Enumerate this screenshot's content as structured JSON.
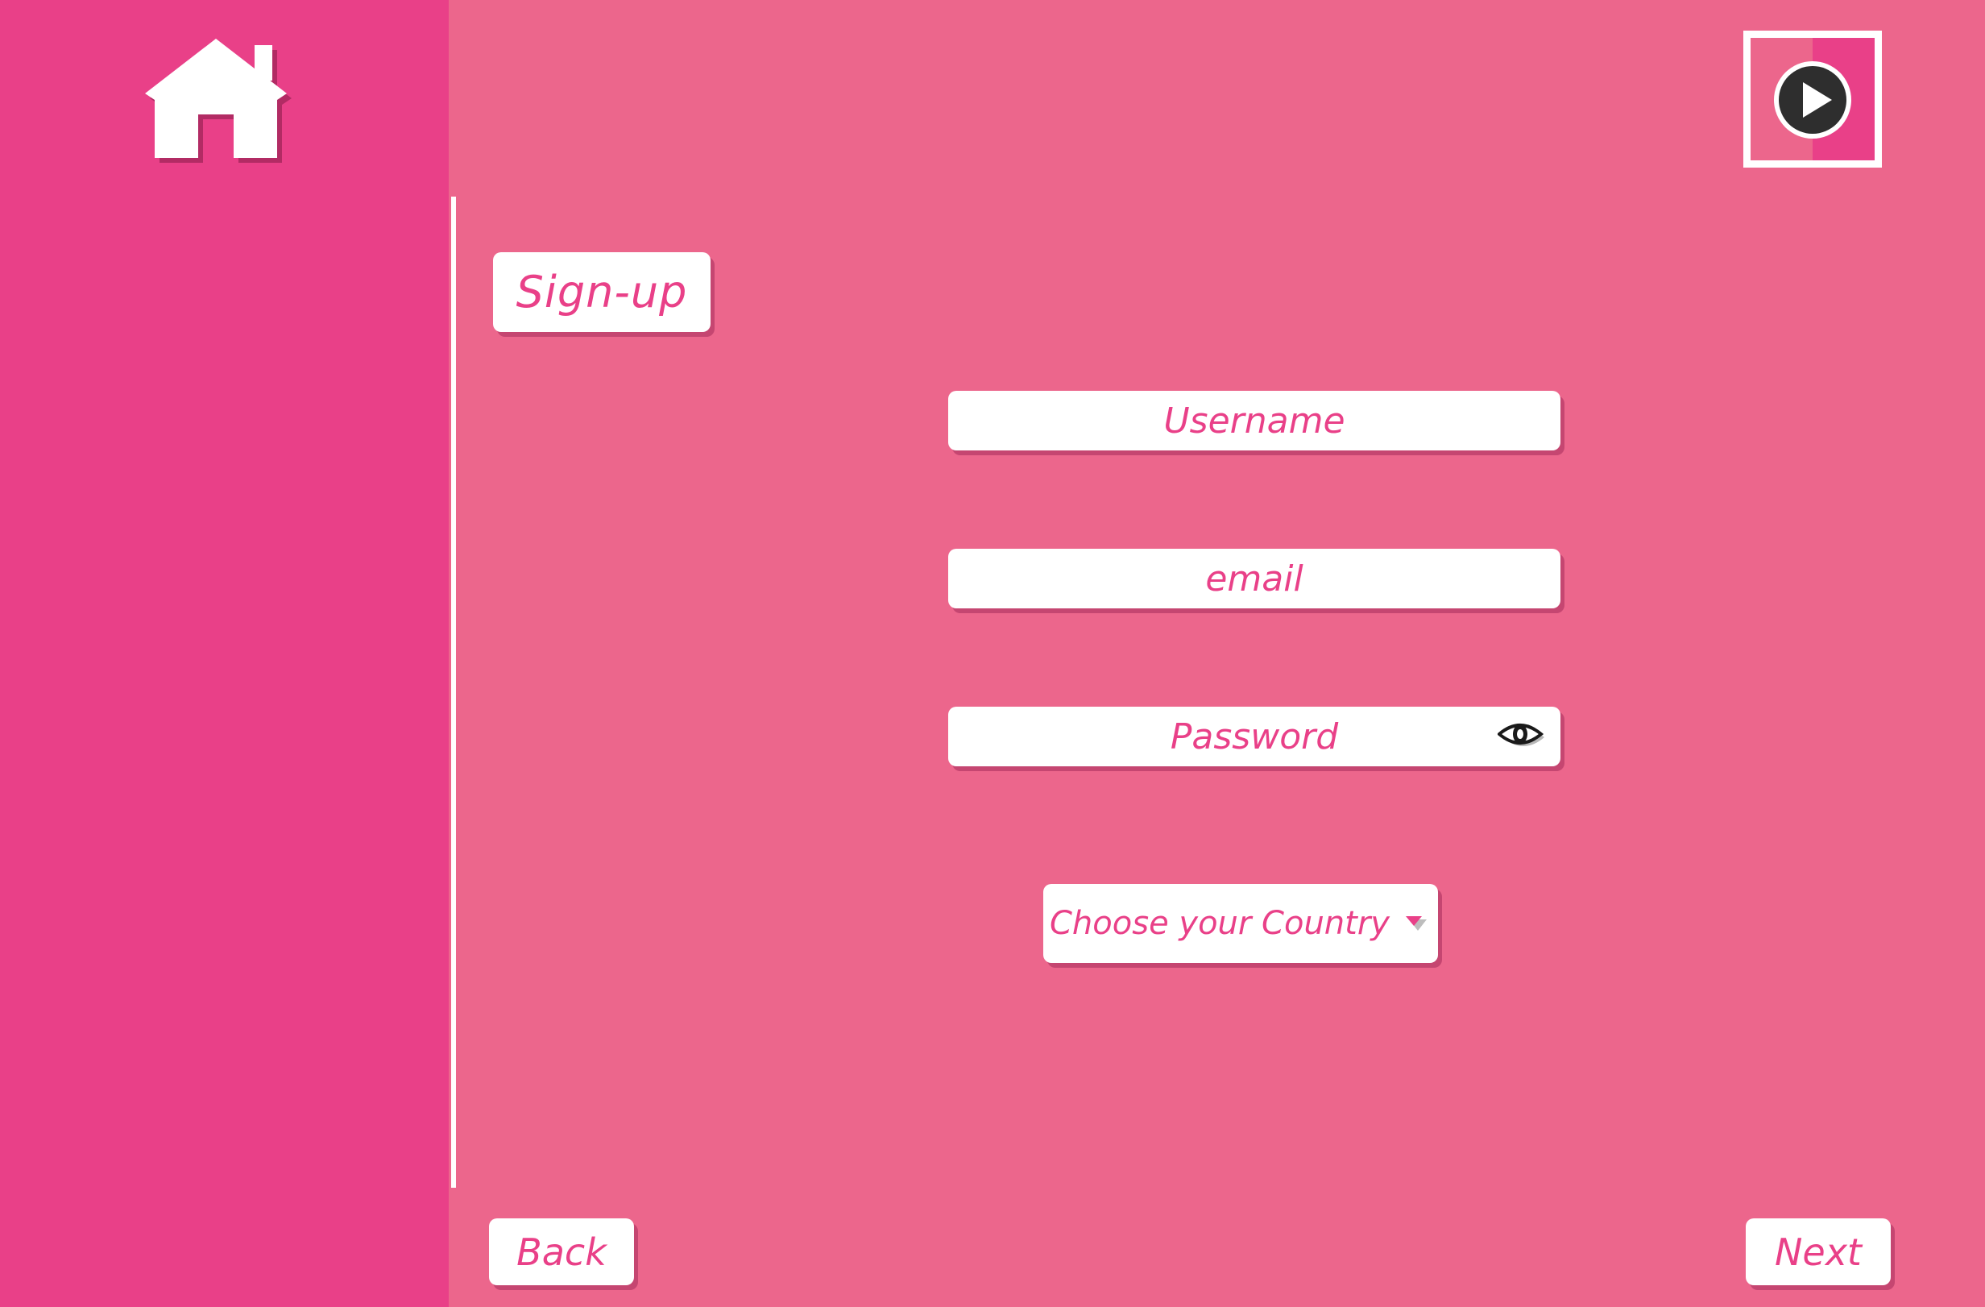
{
  "window": {
    "sidebar_color": "#e94088",
    "background_color": "#ec668c",
    "accent_color": "#e94088"
  },
  "header": {
    "home_icon": "home-icon",
    "video_icon": "play-icon"
  },
  "form": {
    "title": "Sign-up",
    "username": {
      "placeholder": "Username"
    },
    "email": {
      "placeholder": "email"
    },
    "password": {
      "placeholder": "Password",
      "toggle_icon": "eye-icon"
    },
    "country": {
      "selected": "Choose your Country",
      "caret_icon": "caret-down-icon"
    }
  },
  "footer": {
    "back_label": "Back",
    "next_label": "Next"
  }
}
